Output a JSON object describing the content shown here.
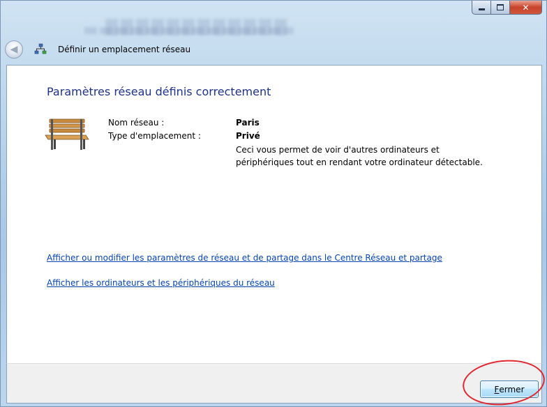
{
  "window": {
    "title": "Définir un emplacement réseau"
  },
  "main": {
    "heading": "Paramètres réseau définis correctement",
    "network_name_label": "Nom réseau :",
    "network_name_value": "Paris",
    "location_type_label": "Type d'emplacement :",
    "location_type_value": "Privé",
    "location_description_line1": "Ceci vous permet de voir d'autres ordinateurs et",
    "location_description_line2": "périphériques tout en rendant votre ordinateur détectable.",
    "link_network_center": "Afficher ou modifier les paramètres de réseau et de partage dans le Centre Réseau et partage",
    "link_view_computers": "Afficher les ordinateurs et les périphériques du réseau"
  },
  "footer": {
    "close_button_accel": "F",
    "close_button_rest": "ermer"
  },
  "colors": {
    "heading": "#1e3287",
    "link": "#0645ad",
    "highlight_ellipse": "#e0262e"
  },
  "icons": {
    "back": "back-arrow-icon",
    "network": "network-icon",
    "location": "park-bench-icon"
  }
}
